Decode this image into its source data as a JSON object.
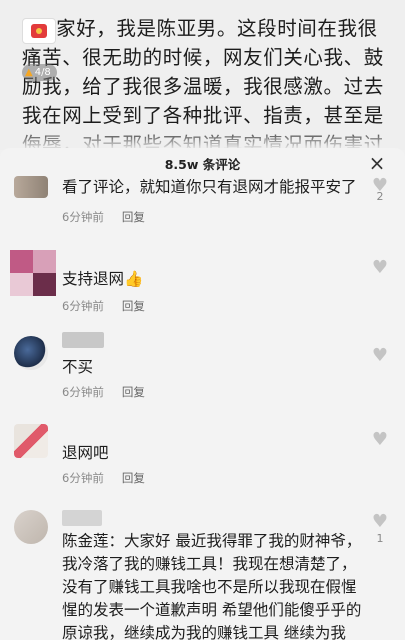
{
  "post": {
    "text": "大家好，我是陈亚男。这段时间在我很痛苦、很无助的时候，网友们关心我、鼓励我，给了我很多温暖，我很感激。过去我在网上受到了各种批评、指责，甚至是侮辱，对于那些不知道真实情况而伤害过我的人",
    "counter": "4/8"
  },
  "panel": {
    "title": "8.5w 条评论",
    "close_icon": "×"
  },
  "comments": [
    {
      "text": "看了评论，就知道你只有退网才能报平安了",
      "time": "6分钟前",
      "reply": "回复",
      "like_count": "2"
    },
    {
      "text": "支持退网",
      "emoji": "👍",
      "time": "6分钟前",
      "reply": "回复",
      "like_count": ""
    },
    {
      "text": "不买",
      "time": "6分钟前",
      "reply": "回复",
      "like_count": ""
    },
    {
      "text": "退网吧",
      "time": "6分钟前",
      "reply": "回复",
      "like_count": ""
    },
    {
      "text": "陈金莲：大家好 最近我得罪了我的财神爷，我冷落了我的赚钱工具！我现在想清楚了，没有了赚钱工具我啥也不是所以我现在假惺惺的发表一个道歉声明 希望他们能傻乎乎的原谅我，继续成为我的赚钱工具 继续为我",
      "time": "",
      "reply": "",
      "like_count": "1"
    }
  ],
  "colors": {
    "accent_like": "#c4c4c4",
    "meta_text": "#8a8a8a"
  }
}
